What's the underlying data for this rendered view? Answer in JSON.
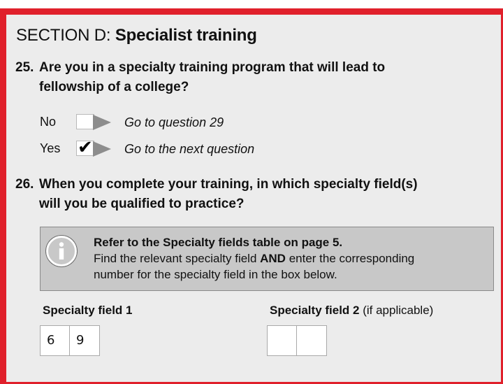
{
  "section": {
    "prefix": "SECTION D: ",
    "title": "Specialist training"
  },
  "q25": {
    "number": "25.",
    "line1": "Are you in a specialty training program that will lead to",
    "line2": "fellowship of a college?",
    "options": [
      {
        "label": "No",
        "checked": false,
        "goto": "Go to question 29"
      },
      {
        "label": "Yes",
        "checked": true,
        "tick": "✔",
        "goto": "Go to the next question"
      }
    ]
  },
  "q26": {
    "number": "26.",
    "line1": "When you complete your training, in which specialty field(s)",
    "line2": "will you be qualified to practice?",
    "info": {
      "line1": "Refer to the Specialty fields table on page 5.",
      "line2_pre": "Find the relevant specialty field ",
      "line2_bold": "AND",
      "line2_post": " enter the corresponding",
      "line3": "number for the specialty field in the box below."
    },
    "field1": {
      "label": "Specialty field 1",
      "digits": [
        "6",
        "9"
      ]
    },
    "field2": {
      "label": "Specialty field 2",
      "note": " (if applicable)",
      "digits": [
        "",
        ""
      ]
    }
  }
}
